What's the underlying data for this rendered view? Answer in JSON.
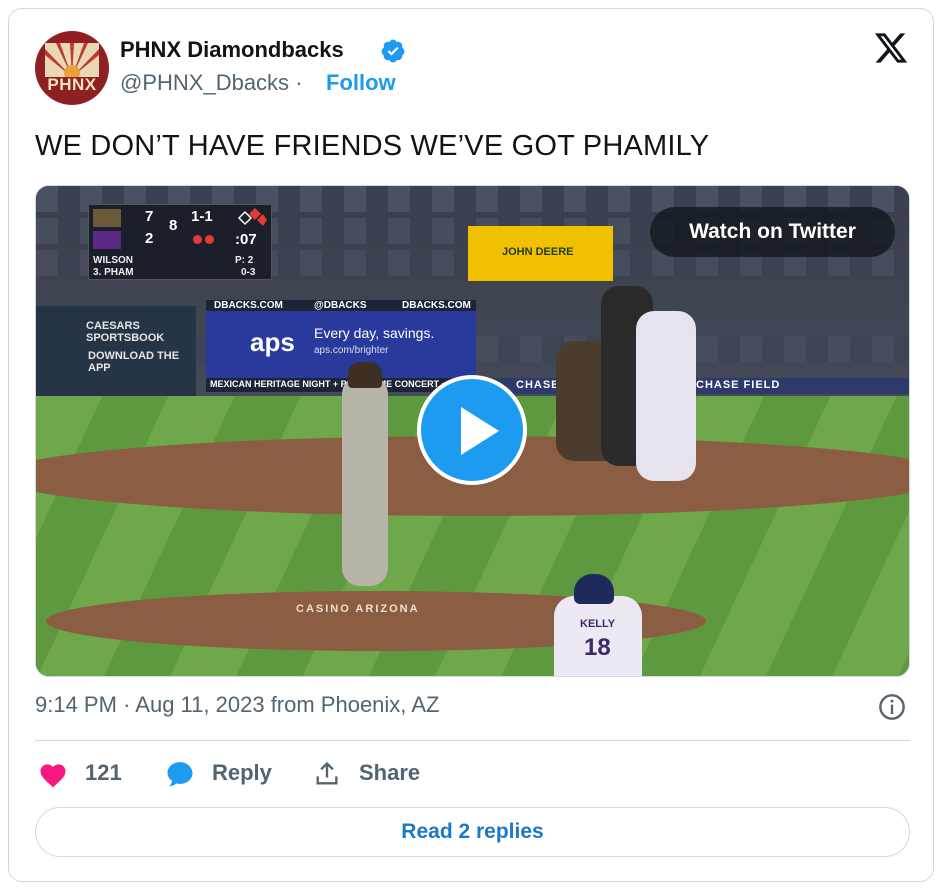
{
  "author": {
    "avatar_text": "PHNX",
    "display_name": "PHNX Diamondbacks",
    "handle": "@PHNX_Dbacks",
    "separator": "·",
    "follow_label": "Follow",
    "verified": true
  },
  "tweet": {
    "text": "WE DON’T HAVE FRIENDS WE’VE GOT PHAMILY"
  },
  "media": {
    "watch_label": "Watch on Twitter",
    "scoreboard": {
      "team1_score": "7",
      "team2_score": "2",
      "inning": "8",
      "count": "1-1",
      "clock": ":07",
      "pitcher": "WILSON",
      "pitches": "P: 2",
      "batter": "3. PHAM",
      "batter_line": "0-3"
    },
    "ads": {
      "ad1": "DBACKS.COM",
      "ad2": "@DBACKS",
      "ad3": "DBACKS.COM",
      "aps_brand": "aps",
      "aps_tagline": "Every day, savings.",
      "aps_url": "aps.com/brighter",
      "sportsbook": "CAESARS SPORTSBOOK",
      "download": "DOWNLOAD THE APP",
      "jd": "JOHN DEERE",
      "chase": "CHASE",
      "chase_field": "CHASE FIELD",
      "mexican": "MEXICAN HERITAGE NIGHT + POSTGAME CONCERT • SEPTEMBER",
      "mound": "CASINO ARIZONA",
      "player_name": "KELLY",
      "player_number": "18"
    }
  },
  "timestamp": {
    "time": "9:14 PM",
    "separator": "·",
    "date": "Aug 11, 2023",
    "location": "from Phoenix, AZ"
  },
  "actions": {
    "likes": "121",
    "reply_label": "Reply",
    "share_label": "Share"
  },
  "read_replies_label": "Read 2 replies",
  "colors": {
    "accent": "#1d9bf0",
    "like": "#f91880",
    "text_secondary": "#536471"
  }
}
